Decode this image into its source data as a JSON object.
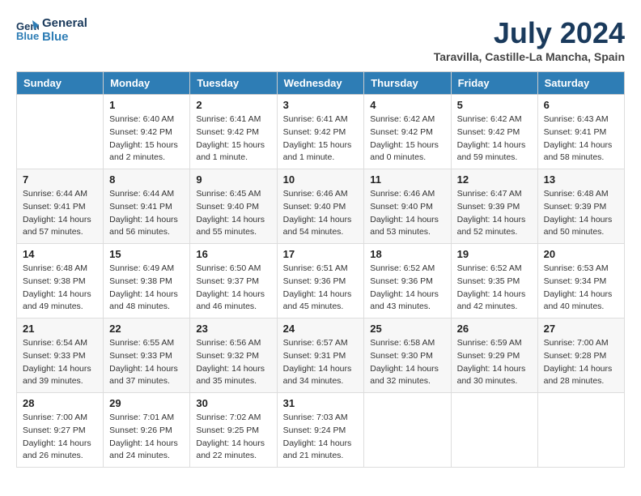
{
  "header": {
    "logo_line1": "General",
    "logo_line2": "Blue",
    "month": "July 2024",
    "location": "Taravilla, Castille-La Mancha, Spain"
  },
  "weekdays": [
    "Sunday",
    "Monday",
    "Tuesday",
    "Wednesday",
    "Thursday",
    "Friday",
    "Saturday"
  ],
  "weeks": [
    [
      {
        "day": "",
        "sunrise": "",
        "sunset": "",
        "daylight": ""
      },
      {
        "day": "1",
        "sunrise": "Sunrise: 6:40 AM",
        "sunset": "Sunset: 9:42 PM",
        "daylight": "Daylight: 15 hours and 2 minutes."
      },
      {
        "day": "2",
        "sunrise": "Sunrise: 6:41 AM",
        "sunset": "Sunset: 9:42 PM",
        "daylight": "Daylight: 15 hours and 1 minute."
      },
      {
        "day": "3",
        "sunrise": "Sunrise: 6:41 AM",
        "sunset": "Sunset: 9:42 PM",
        "daylight": "Daylight: 15 hours and 1 minute."
      },
      {
        "day": "4",
        "sunrise": "Sunrise: 6:42 AM",
        "sunset": "Sunset: 9:42 PM",
        "daylight": "Daylight: 15 hours and 0 minutes."
      },
      {
        "day": "5",
        "sunrise": "Sunrise: 6:42 AM",
        "sunset": "Sunset: 9:42 PM",
        "daylight": "Daylight: 14 hours and 59 minutes."
      },
      {
        "day": "6",
        "sunrise": "Sunrise: 6:43 AM",
        "sunset": "Sunset: 9:41 PM",
        "daylight": "Daylight: 14 hours and 58 minutes."
      }
    ],
    [
      {
        "day": "7",
        "sunrise": "Sunrise: 6:44 AM",
        "sunset": "Sunset: 9:41 PM",
        "daylight": "Daylight: 14 hours and 57 minutes."
      },
      {
        "day": "8",
        "sunrise": "Sunrise: 6:44 AM",
        "sunset": "Sunset: 9:41 PM",
        "daylight": "Daylight: 14 hours and 56 minutes."
      },
      {
        "day": "9",
        "sunrise": "Sunrise: 6:45 AM",
        "sunset": "Sunset: 9:40 PM",
        "daylight": "Daylight: 14 hours and 55 minutes."
      },
      {
        "day": "10",
        "sunrise": "Sunrise: 6:46 AM",
        "sunset": "Sunset: 9:40 PM",
        "daylight": "Daylight: 14 hours and 54 minutes."
      },
      {
        "day": "11",
        "sunrise": "Sunrise: 6:46 AM",
        "sunset": "Sunset: 9:40 PM",
        "daylight": "Daylight: 14 hours and 53 minutes."
      },
      {
        "day": "12",
        "sunrise": "Sunrise: 6:47 AM",
        "sunset": "Sunset: 9:39 PM",
        "daylight": "Daylight: 14 hours and 52 minutes."
      },
      {
        "day": "13",
        "sunrise": "Sunrise: 6:48 AM",
        "sunset": "Sunset: 9:39 PM",
        "daylight": "Daylight: 14 hours and 50 minutes."
      }
    ],
    [
      {
        "day": "14",
        "sunrise": "Sunrise: 6:48 AM",
        "sunset": "Sunset: 9:38 PM",
        "daylight": "Daylight: 14 hours and 49 minutes."
      },
      {
        "day": "15",
        "sunrise": "Sunrise: 6:49 AM",
        "sunset": "Sunset: 9:38 PM",
        "daylight": "Daylight: 14 hours and 48 minutes."
      },
      {
        "day": "16",
        "sunrise": "Sunrise: 6:50 AM",
        "sunset": "Sunset: 9:37 PM",
        "daylight": "Daylight: 14 hours and 46 minutes."
      },
      {
        "day": "17",
        "sunrise": "Sunrise: 6:51 AM",
        "sunset": "Sunset: 9:36 PM",
        "daylight": "Daylight: 14 hours and 45 minutes."
      },
      {
        "day": "18",
        "sunrise": "Sunrise: 6:52 AM",
        "sunset": "Sunset: 9:36 PM",
        "daylight": "Daylight: 14 hours and 43 minutes."
      },
      {
        "day": "19",
        "sunrise": "Sunrise: 6:52 AM",
        "sunset": "Sunset: 9:35 PM",
        "daylight": "Daylight: 14 hours and 42 minutes."
      },
      {
        "day": "20",
        "sunrise": "Sunrise: 6:53 AM",
        "sunset": "Sunset: 9:34 PM",
        "daylight": "Daylight: 14 hours and 40 minutes."
      }
    ],
    [
      {
        "day": "21",
        "sunrise": "Sunrise: 6:54 AM",
        "sunset": "Sunset: 9:33 PM",
        "daylight": "Daylight: 14 hours and 39 minutes."
      },
      {
        "day": "22",
        "sunrise": "Sunrise: 6:55 AM",
        "sunset": "Sunset: 9:33 PM",
        "daylight": "Daylight: 14 hours and 37 minutes."
      },
      {
        "day": "23",
        "sunrise": "Sunrise: 6:56 AM",
        "sunset": "Sunset: 9:32 PM",
        "daylight": "Daylight: 14 hours and 35 minutes."
      },
      {
        "day": "24",
        "sunrise": "Sunrise: 6:57 AM",
        "sunset": "Sunset: 9:31 PM",
        "daylight": "Daylight: 14 hours and 34 minutes."
      },
      {
        "day": "25",
        "sunrise": "Sunrise: 6:58 AM",
        "sunset": "Sunset: 9:30 PM",
        "daylight": "Daylight: 14 hours and 32 minutes."
      },
      {
        "day": "26",
        "sunrise": "Sunrise: 6:59 AM",
        "sunset": "Sunset: 9:29 PM",
        "daylight": "Daylight: 14 hours and 30 minutes."
      },
      {
        "day": "27",
        "sunrise": "Sunrise: 7:00 AM",
        "sunset": "Sunset: 9:28 PM",
        "daylight": "Daylight: 14 hours and 28 minutes."
      }
    ],
    [
      {
        "day": "28",
        "sunrise": "Sunrise: 7:00 AM",
        "sunset": "Sunset: 9:27 PM",
        "daylight": "Daylight: 14 hours and 26 minutes."
      },
      {
        "day": "29",
        "sunrise": "Sunrise: 7:01 AM",
        "sunset": "Sunset: 9:26 PM",
        "daylight": "Daylight: 14 hours and 24 minutes."
      },
      {
        "day": "30",
        "sunrise": "Sunrise: 7:02 AM",
        "sunset": "Sunset: 9:25 PM",
        "daylight": "Daylight: 14 hours and 22 minutes."
      },
      {
        "day": "31",
        "sunrise": "Sunrise: 7:03 AM",
        "sunset": "Sunset: 9:24 PM",
        "daylight": "Daylight: 14 hours and 21 minutes."
      },
      {
        "day": "",
        "sunrise": "",
        "sunset": "",
        "daylight": ""
      },
      {
        "day": "",
        "sunrise": "",
        "sunset": "",
        "daylight": ""
      },
      {
        "day": "",
        "sunrise": "",
        "sunset": "",
        "daylight": ""
      }
    ]
  ]
}
